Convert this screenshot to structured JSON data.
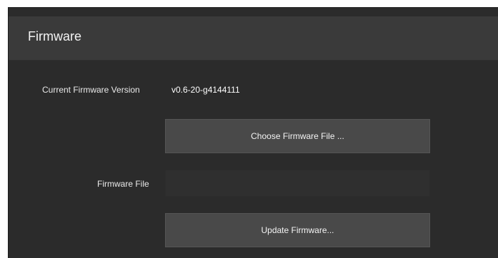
{
  "panel": {
    "title": "Firmware"
  },
  "current_version": {
    "label": "Current Firmware Version",
    "value": "v0.6-20-g4144111"
  },
  "buttons": {
    "choose_label": "Choose Firmware File ...",
    "update_label": "Update Firmware..."
  },
  "firmware_file": {
    "label": "Firmware File",
    "value": ""
  },
  "colors": {
    "panel_bg": "#2b2b2b",
    "header_bg": "#3a3a3a",
    "button_bg": "#494949",
    "input_bg": "#2f2f2f",
    "text": "#f2f2f2"
  }
}
